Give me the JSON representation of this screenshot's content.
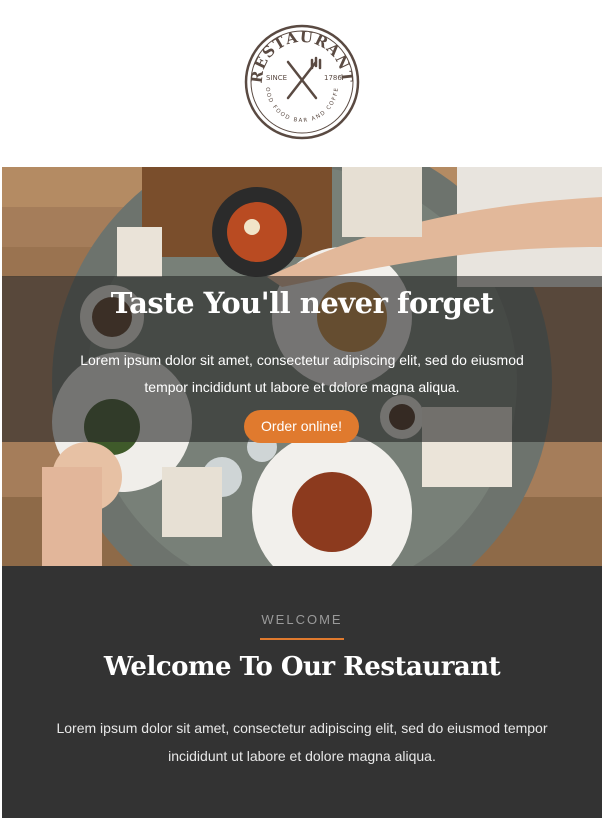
{
  "logo": {
    "name": "RESTAURANT",
    "since_label": "SINCE",
    "year": "1786",
    "tagline": "GOOD FOOD BAR AND COFFEE"
  },
  "hero": {
    "title": "Taste You'll never forget",
    "text": "Lorem ipsum dolor sit amet, consectetur adipiscing elit, sed do eiusmod tempor incididunt ut labore et dolore magna aliqua.",
    "button_label": "Order online!"
  },
  "welcome": {
    "kicker": "WELCOME",
    "title": "Welcome To Our Restaurant",
    "text": "Lorem ipsum dolor sit amet, consectetur adipiscing elit, sed do eiusmod tempor incididunt ut labore et dolore magna aliqua."
  },
  "colors": {
    "accent": "#e07a2e",
    "dark_section": "#333333",
    "logo_brown": "#5a4a42"
  }
}
